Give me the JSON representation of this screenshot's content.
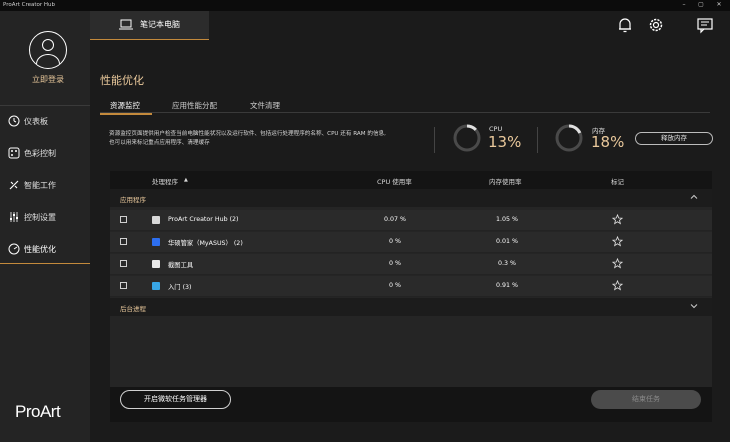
{
  "window": {
    "title": "ProArt Creator Hub",
    "controls": [
      "–",
      "▢",
      "✕"
    ]
  },
  "sidebar": {
    "login_label": "立即登录",
    "items": [
      {
        "label": "仪表板",
        "icon": "dashboard-icon"
      },
      {
        "label": "色彩控制",
        "icon": "color-palette-icon"
      },
      {
        "label": "智能工作",
        "icon": "smart-work-icon"
      },
      {
        "label": "控制设置",
        "icon": "sliders-icon"
      },
      {
        "label": "性能优化",
        "icon": "performance-icon",
        "active": true
      }
    ],
    "logo": "ProArt"
  },
  "header": {
    "device_tab": "笔记本电脑",
    "icons": [
      "bell-icon",
      "gear-icon",
      "feedback-icon"
    ]
  },
  "page": {
    "title": "性能优化",
    "tabs": [
      {
        "label": "资源监控",
        "active": true
      },
      {
        "label": "应用性能分配"
      },
      {
        "label": "文件清理"
      }
    ],
    "description_line1": "资源监控页面提供用户检查当前电脑性能状况以及运行软件、包括运行处理程序的名称、CPU 还有 RAM 的信息,",
    "description_line2": "也可以用来标记重点应用程序、清理缓存",
    "cpu": {
      "label": "CPU",
      "value": "13%",
      "percent": 13
    },
    "memory": {
      "label": "内存",
      "value": "18%",
      "percent": 18
    },
    "release_memory_button": "释放内存"
  },
  "table": {
    "headers": {
      "process": "处理程序",
      "sort_indicator": "▲",
      "cpu": "CPU 使用率",
      "memory": "内存使用率",
      "mark": "标记"
    },
    "groups": {
      "apps_label": "应用程序",
      "background_label": "后台进程"
    },
    "rows": [
      {
        "name": "ProArt Creator Hub (2)",
        "cpu": "0.07 %",
        "memory": "1.05 %",
        "icon_color": "#d8d8d8"
      },
      {
        "name": "华硕管家（MyASUS） (2)",
        "cpu": "0 %",
        "memory": "0.01 %",
        "icon_color": "#2d6ff0"
      },
      {
        "name": "截图工具",
        "cpu": "0 %",
        "memory": "0.3 %",
        "icon_color": "#e8e8e8"
      },
      {
        "name": "入门 (3)",
        "cpu": "0 %",
        "memory": "0.91 %",
        "icon_color": "#38a6e6"
      }
    ]
  },
  "footer": {
    "task_manager_button": "开启微软任务管理器",
    "end_task_button": "结束任务"
  },
  "colors": {
    "accent_gold": "#e9c89b",
    "underline": "#c48a3c"
  }
}
